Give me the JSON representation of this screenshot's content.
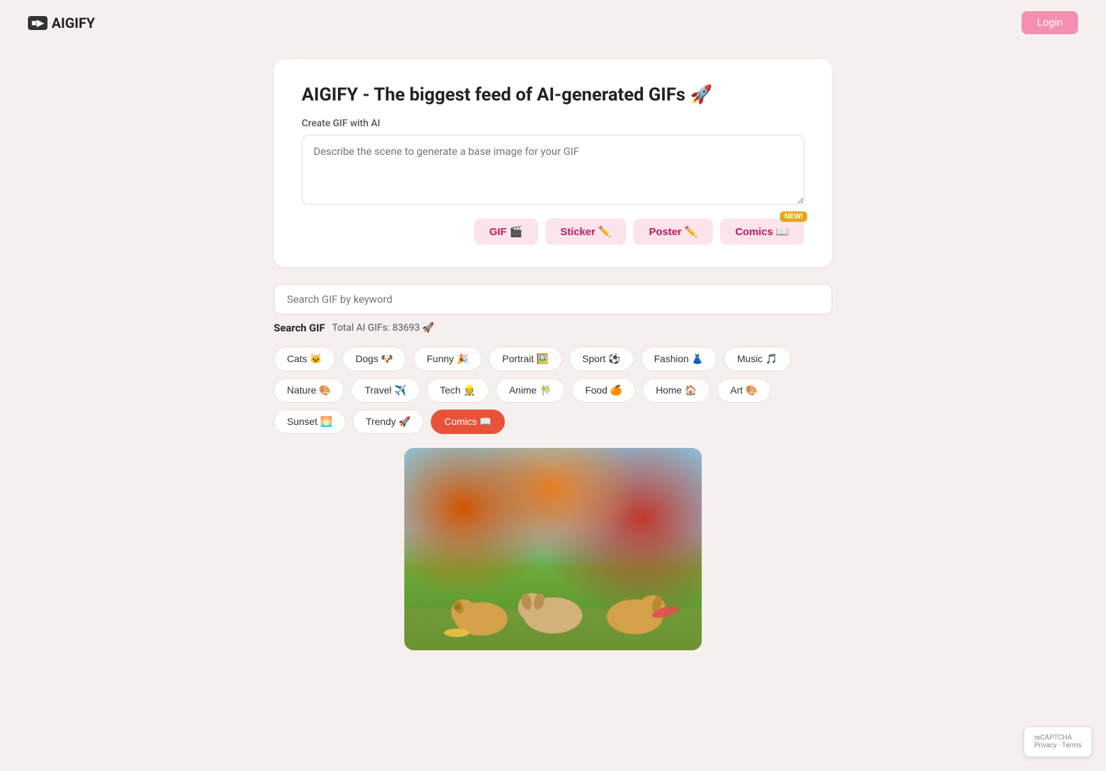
{
  "header": {
    "logo_text": "AIGIFY",
    "logo_icon": "📹",
    "login_label": "Login"
  },
  "hero": {
    "title": "AIGIFY - The biggest feed of AI-generated GIFs 🚀",
    "create_label": "Create GIF with AI",
    "prompt_placeholder": "Describe the scene to generate a base image for your GIF",
    "type_buttons": [
      {
        "label": "GIF 🎬",
        "id": "gif",
        "new": false
      },
      {
        "label": "Sticker ✏️",
        "id": "sticker",
        "new": false
      },
      {
        "label": "Poster ✏️",
        "id": "poster",
        "new": false
      },
      {
        "label": "Comics 📖",
        "id": "comics",
        "new": true
      }
    ],
    "new_badge_text": "NEW!"
  },
  "search": {
    "placeholder": "Search GIF by keyword",
    "search_label": "Search GIF",
    "total_label": "Total AI GIFs:",
    "total_count": "83693",
    "total_icon": "🚀"
  },
  "categories": [
    {
      "label": "Cats 🐱",
      "id": "cats",
      "active": false
    },
    {
      "label": "Dogs 🐶",
      "id": "dogs",
      "active": false
    },
    {
      "label": "Funny 🎉",
      "id": "funny",
      "active": false
    },
    {
      "label": "Portrait 🖼️",
      "id": "portrait",
      "active": false
    },
    {
      "label": "Sport ⚽",
      "id": "sport",
      "active": false
    },
    {
      "label": "Fashion 👗",
      "id": "fashion",
      "active": false
    },
    {
      "label": "Music 🎵",
      "id": "music",
      "active": false
    },
    {
      "label": "Nature 🎨",
      "id": "nature",
      "active": false
    },
    {
      "label": "Travel ✈️",
      "id": "travel",
      "active": false
    },
    {
      "label": "Tech 👷",
      "id": "tech",
      "active": false
    },
    {
      "label": "Anime 🎋",
      "id": "anime",
      "active": false
    },
    {
      "label": "Food 🍊",
      "id": "food",
      "active": false
    },
    {
      "label": "Home 🏠",
      "id": "home",
      "active": false
    },
    {
      "label": "Art 🎨",
      "id": "art",
      "active": false
    },
    {
      "label": "Sunset 🌅",
      "id": "sunset",
      "active": false
    },
    {
      "label": "Trendy 🚀",
      "id": "trendy",
      "active": false
    },
    {
      "label": "Comics 📖",
      "id": "comics",
      "active": true
    }
  ],
  "recaptcha": {
    "text": "reCAPTCHA\nPrivacy · Terms"
  }
}
